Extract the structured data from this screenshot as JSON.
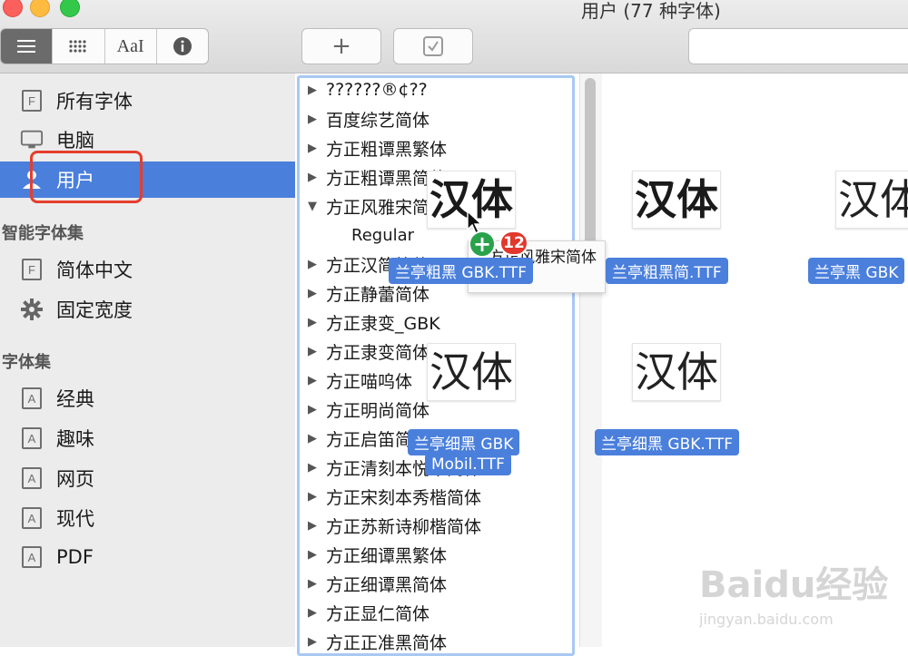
{
  "window": {
    "title": "用户 (77 种字体)"
  },
  "toolbar": {
    "view_buttons": [
      {
        "name": "list-view-icon",
        "glyph": "☰"
      },
      {
        "name": "grid-view-icon",
        "glyph": "⋮⋮"
      },
      {
        "name": "sample-view-icon",
        "glyph": "AaI"
      },
      {
        "name": "info-icon",
        "glyph": "i"
      }
    ],
    "add_label": "+",
    "check_label": "☑"
  },
  "sidebar": {
    "items": [
      {
        "label": "所有字体",
        "icon": "font-file-icon"
      },
      {
        "label": "电脑",
        "icon": "computer-icon"
      },
      {
        "label": "用户",
        "icon": "user-icon"
      }
    ],
    "smart_header": "智能字体集",
    "smart_items": [
      {
        "label": "简体中文",
        "icon": "font-file-icon"
      },
      {
        "label": "固定宽度",
        "icon": "gear-icon"
      }
    ],
    "collections_header": "字体集",
    "collections": [
      {
        "label": "经典",
        "icon": "collection-icon"
      },
      {
        "label": "趣味",
        "icon": "collection-icon"
      },
      {
        "label": "网页",
        "icon": "collection-icon"
      },
      {
        "label": "现代",
        "icon": "collection-icon"
      },
      {
        "label": "PDF",
        "icon": "collection-icon"
      }
    ],
    "selected_color": "#4a7fdc",
    "highlight_color": "#e53e2d"
  },
  "font_list": [
    "??????®¢??",
    "百度综艺简体",
    "方正粗谭黑繁体",
    "方正粗谭黑简体",
    "方正风雅宋简体",
    "Regular",
    "方正汉简简体",
    "方正静蕾简体",
    "方正隶变_GBK",
    "方正隶变简体",
    "方正喵呜体",
    "方正明尚简体",
    "方正启笛简体",
    "方正清刻本悦宋简体",
    "方正宋刻本秀楷简体",
    "方正苏新诗柳楷简体",
    "方正细谭黑繁体",
    "方正细谭黑简体",
    "方正显仁简体",
    "方正正准黑简体"
  ],
  "drag": {
    "sample_text": "汉体",
    "files": [
      "兰亭粗黑 GBK.TTF",
      "兰亭粗黑简.TTF",
      "兰亭黑 GBK",
      "兰亭细黑 GBK",
      "Mobil.TTF",
      "兰亭细黑 GBK.TTF"
    ],
    "count": "12",
    "plus": "+",
    "tip_text": "方正风雅宋简体"
  },
  "watermark": {
    "brand": "Baidu经验",
    "url": "jingyan.baidu.com"
  }
}
